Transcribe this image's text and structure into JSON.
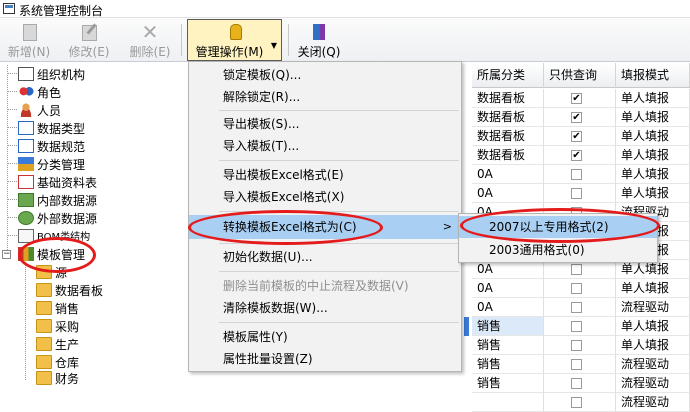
{
  "window": {
    "title": "系统管理控制台"
  },
  "toolbar": {
    "new": "新增(N)",
    "edit": "修改(E)",
    "delete": "删除(E)",
    "manage": "管理操作(M)",
    "close": "关闭(Q)"
  },
  "tree": [
    "组织机构",
    "角色",
    "人员",
    "数据类型",
    "数据规范",
    "分类管理",
    "基础资料表",
    "内部数据源",
    "外部数据源",
    "BOM类结构",
    "模板管理",
    "源",
    "数据看板",
    "销售",
    "采购",
    "生产",
    "仓库",
    "财务"
  ],
  "grid": {
    "headers": [
      "所属分类",
      "只供查询",
      "填报模式"
    ],
    "rows": [
      {
        "cat": "数据看板",
        "query": true,
        "mode": "单人填报"
      },
      {
        "cat": "数据看板",
        "query": true,
        "mode": "单人填报"
      },
      {
        "cat": "数据看板",
        "query": true,
        "mode": "单人填报"
      },
      {
        "cat": "数据看板",
        "query": true,
        "mode": "单人填报"
      },
      {
        "cat": "0A",
        "query": false,
        "mode": "单人填报"
      },
      {
        "cat": "0A",
        "query": false,
        "mode": "单人填报"
      },
      {
        "cat": "0A",
        "query": false,
        "mode": "流程驱动"
      },
      {
        "cat": "",
        "query": false,
        "mode": "单人填报"
      },
      {
        "cat": "",
        "query": false,
        "mode": "单人填报"
      },
      {
        "cat": "0A",
        "query": false,
        "mode": "单人填报"
      },
      {
        "cat": "0A",
        "query": false,
        "mode": "单人填报"
      },
      {
        "cat": "0A",
        "query": false,
        "mode": "流程驱动"
      },
      {
        "cat": "销售",
        "query": false,
        "mode": "单人填报"
      },
      {
        "cat": "销售",
        "query": false,
        "mode": "单人填报"
      },
      {
        "cat": "销售",
        "query": false,
        "mode": "流程驱动"
      },
      {
        "cat": "销售",
        "query": false,
        "mode": "流程驱动"
      },
      {
        "cat": "",
        "query": false,
        "mode": "流程驱动"
      }
    ]
  },
  "menu": {
    "items": [
      "锁定模板(Q)...",
      "解除锁定(R)...",
      "导出模板(S)...",
      "导入模板(T)...",
      "导出模板Excel格式(E)",
      "导入模板Excel格式(X)",
      "转换模板Excel格式为(C)",
      "初始化数据(U)...",
      "删除当前模板的中止流程及数据(V)",
      "清除模板数据(W)...",
      "模板属性(Y)",
      "属性批量设置(Z)"
    ]
  },
  "submenu": {
    "items": [
      "2007以上专用格式(2)",
      "2003通用格式(0)"
    ]
  },
  "colors": {
    "highlight": "#a9cff3",
    "annotation": "#e41b1b",
    "active_button": "#fff3c2"
  }
}
